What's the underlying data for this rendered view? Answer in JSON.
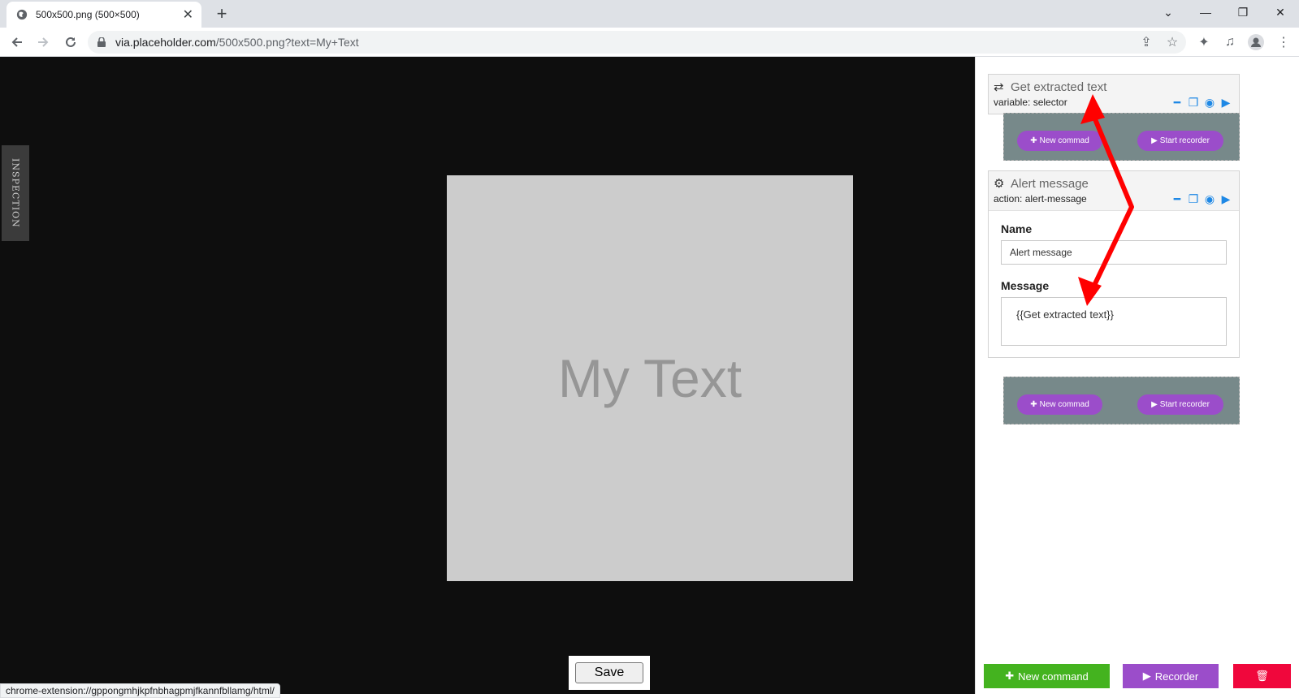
{
  "browser": {
    "tab_title": "500x500.png (500×500)",
    "url_host": "via.placeholder.com",
    "url_path": "/500x500.png?text=My+Text",
    "status_url": "chrome-extension://gppongmhjkpfnbhagpmjfkannfbllamg/html/"
  },
  "page": {
    "image_text": "My Text",
    "inspection_tab": "INSPECTION",
    "save_label": "Save"
  },
  "panel": {
    "commands": [
      {
        "title": "Get extracted text",
        "subtitle": "variable: selector",
        "icon": "swap-arrows-icon"
      },
      {
        "title": "Alert message",
        "subtitle": "action: alert-message",
        "icon": "gear-icon",
        "fields": {
          "name_label": "Name",
          "name_value": "Alert message",
          "message_label": "Message",
          "message_value": "{{Get extracted text}}"
        }
      }
    ],
    "dropzone": {
      "new_command": "New commad",
      "start_recorder": "Start recorder"
    },
    "bottom": {
      "new_command": "New command",
      "recorder": "Recorder"
    }
  },
  "colors": {
    "purple": "#9b4dca",
    "green": "#44b31f",
    "red": "#f0073c",
    "dropzone": "#77898a",
    "arrow": "#ff0000",
    "action_blue": "#1e88e5"
  }
}
